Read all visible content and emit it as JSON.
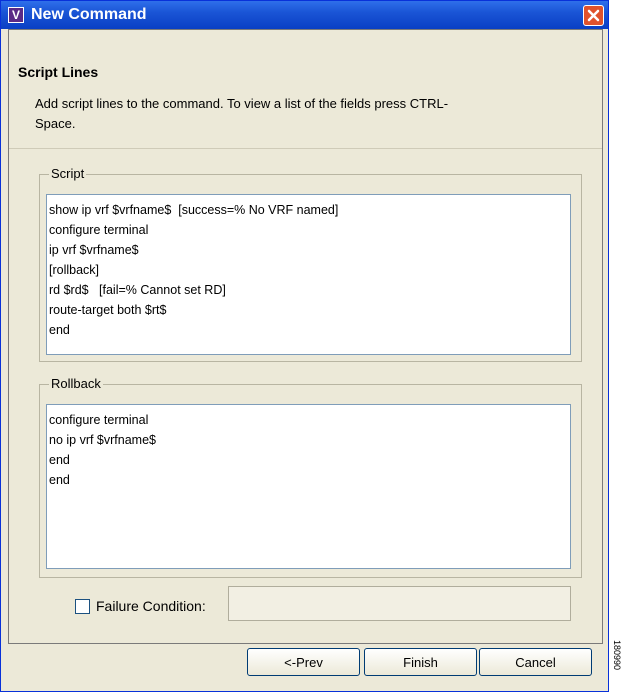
{
  "window": {
    "title": "New Command",
    "app_icon_letter": "V"
  },
  "header": {
    "section_title": "Script Lines",
    "description": "Add script lines to the command. To view a list of the fields press CTRL-Space."
  },
  "script": {
    "label": "Script",
    "lines": [
      "show ip vrf $vrfname$  [success=% No VRF named]",
      "configure terminal",
      "ip vrf $vrfname$",
      "[rollback]",
      "rd $rd$   [fail=% Cannot set RD]",
      "route-target both $rt$",
      "end"
    ]
  },
  "rollback": {
    "label": "Rollback",
    "lines": [
      "configure terminal",
      "no ip vrf $vrfname$",
      "end",
      "end"
    ]
  },
  "failure": {
    "label": "Failure Condition:",
    "checked": false,
    "value": ""
  },
  "buttons": {
    "prev": "<-Prev",
    "finish": "Finish",
    "cancel": "Cancel"
  },
  "side_code": "180990"
}
